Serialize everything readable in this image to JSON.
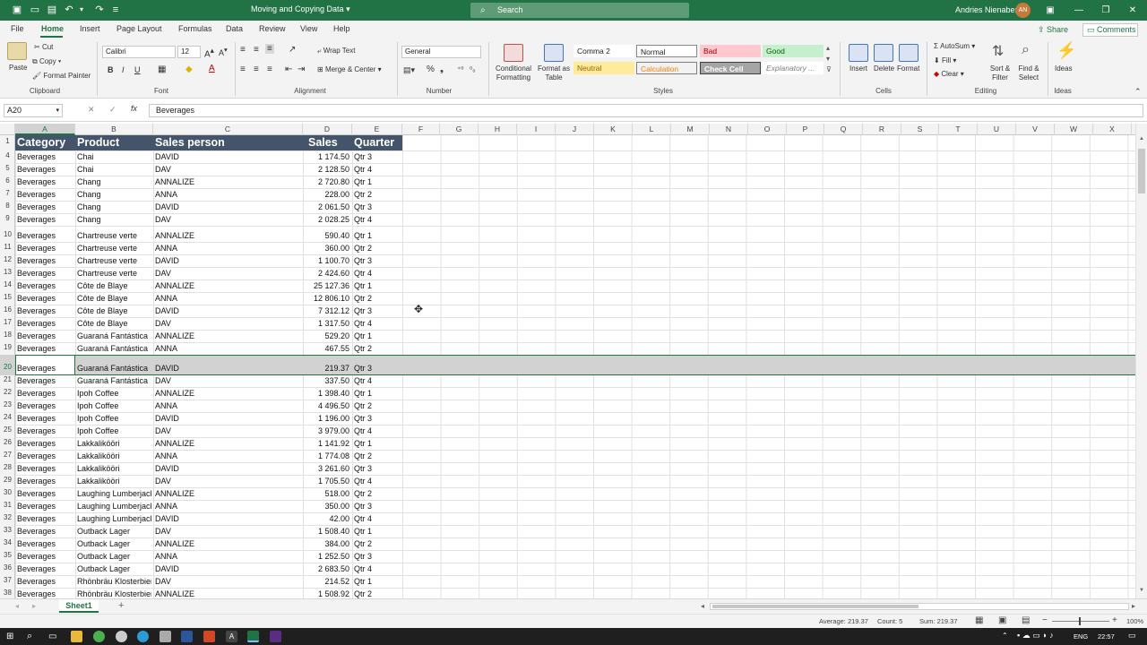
{
  "titlebar": {
    "title": "Moving and Copying Data",
    "title_caret": "▾",
    "search_placeholder": "Search",
    "user_name": "Andries Nienaber",
    "user_initials": "AN",
    "autosave_icon": "excel-logo",
    "qa_icons": [
      "open-icon",
      "save-icon",
      "undo-icon",
      "redo-icon",
      "customize-icon"
    ]
  },
  "menu": {
    "items": [
      "File",
      "Home",
      "Insert",
      "Page Layout",
      "Formulas",
      "Data",
      "Review",
      "View",
      "Help"
    ],
    "share": "Share",
    "comments": "Comments"
  },
  "ribbon": {
    "clipboard": {
      "paste": "Paste",
      "cut": "Cut",
      "copy": "Copy",
      "format_painter": "Format Painter",
      "group": "Clipboard"
    },
    "font": {
      "name": "Calibri",
      "size": "12",
      "group": "Font",
      "bold": "B",
      "italic": "I",
      "underline": "U"
    },
    "alignment": {
      "wrap": "Wrap Text",
      "merge": "Merge & Center",
      "group": "Alignment"
    },
    "number": {
      "format": "General",
      "group": "Number"
    },
    "styles": {
      "conditional": "Conditional Formatting",
      "format_table": "Format as Table",
      "cells": [
        {
          "label": "Comma 2",
          "bg": "#ffffff",
          "fg": "#222222"
        },
        {
          "label": "Normal",
          "bg": "#ffffff",
          "fg": "#222222"
        },
        {
          "label": "Bad",
          "bg": "#ffc7ce",
          "fg": "#9c0006"
        },
        {
          "label": "Good",
          "bg": "#c6efce",
          "fg": "#006100"
        },
        {
          "label": "Neutral",
          "bg": "#ffeb9c",
          "fg": "#9c6500"
        },
        {
          "label": "Calculation",
          "bg": "#f2f2f2",
          "fg": "#fa7d00"
        },
        {
          "label": "Check Cell",
          "bg": "#a5a5a5",
          "fg": "#ffffff"
        },
        {
          "label": "Explanatory ...",
          "bg": "#ffffff",
          "fg": "#7f7f7f"
        }
      ],
      "group": "Styles"
    },
    "cells": {
      "insert": "Insert",
      "delete": "Delete",
      "format": "Format",
      "group": "Cells"
    },
    "editing": {
      "autosum": "AutoSum",
      "fill": "Fill",
      "clear": "Clear",
      "sort": "Sort & Filter",
      "find": "Find & Select",
      "group": "Editing"
    },
    "ideas": {
      "label": "Ideas",
      "group": "Ideas"
    }
  },
  "formula_bar": {
    "name_box": "A20",
    "content": "Beverages",
    "fx": "fx"
  },
  "columns": [
    "A",
    "B",
    "C",
    "D",
    "E",
    "F",
    "G",
    "H",
    "I",
    "J",
    "K",
    "L",
    "M",
    "N",
    "O",
    "P",
    "Q",
    "R",
    "S",
    "T",
    "U",
    "V",
    "W",
    "X"
  ],
  "headers": [
    "Category",
    "Product",
    "Sales person",
    "Sales",
    "Quarter"
  ],
  "rows": [
    {
      "n": "4",
      "c": "Beverages",
      "p": "Chai",
      "s": "DAVID",
      "v": "1 174.50",
      "q": "Qtr 3"
    },
    {
      "n": "5",
      "c": "Beverages",
      "p": "Chai",
      "s": "DAV",
      "v": "2 128.50",
      "q": "Qtr 4"
    },
    {
      "n": "6",
      "c": "Beverages",
      "p": "Chang",
      "s": "ANNALIZE",
      "v": "2 720.80",
      "q": "Qtr 1"
    },
    {
      "n": "7",
      "c": "Beverages",
      "p": "Chang",
      "s": "ANNA",
      "v": "228.00",
      "q": "Qtr 2"
    },
    {
      "n": "8",
      "c": "Beverages",
      "p": "Chang",
      "s": "DAVID",
      "v": "2 061.50",
      "q": "Qtr 3"
    },
    {
      "n": "9",
      "c": "Beverages",
      "p": "Chang",
      "s": "DAV",
      "v": "2 028.25",
      "q": "Qtr 4"
    },
    {
      "n": "10",
      "c": "Beverages",
      "p": "Chartreuse    verte",
      "s": "ANNALIZE",
      "v": "590.40",
      "q": "Qtr 1"
    },
    {
      "n": "11",
      "c": "Beverages",
      "p": "Chartreuse verte",
      "s": "ANNA",
      "v": "360.00",
      "q": "Qtr 2"
    },
    {
      "n": "12",
      "c": "Beverages",
      "p": "Chartreuse verte",
      "s": "DAVID",
      "v": "1 100.70",
      "q": "Qtr 3"
    },
    {
      "n": "13",
      "c": "Beverages",
      "p": "Chartreuse verte",
      "s": "DAV",
      "v": "2 424.60",
      "q": "Qtr 4"
    },
    {
      "n": "14",
      "c": "Beverages",
      "p": "Côte de Blaye",
      "s": "ANNALIZE",
      "v": "25 127.36",
      "q": "Qtr 1"
    },
    {
      "n": "15",
      "c": "Beverages",
      "p": "Côte de Blaye",
      "s": "ANNA",
      "v": "12 806.10",
      "q": "Qtr 2"
    },
    {
      "n": "16",
      "c": "Beverages",
      "p": "Côte de Blaye",
      "s": "DAVID",
      "v": "7 312.12",
      "q": "Qtr 3"
    },
    {
      "n": "17",
      "c": "Beverages",
      "p": "Côte de Blaye",
      "s": "DAV",
      "v": "1 317.50",
      "q": "Qtr 4"
    },
    {
      "n": "18",
      "c": "Beverages",
      "p": "Guaraná Fantástica",
      "s": "ANNALIZE",
      "v": "529.20",
      "q": "Qtr 1"
    },
    {
      "n": "19",
      "c": "Beverages",
      "p": "Guaraná Fantástica",
      "s": "ANNA",
      "v": "467.55",
      "q": "Qtr 2"
    },
    {
      "n": "20",
      "c": "Beverages",
      "p": "Guaraná Fantástica",
      "s": "DAVID",
      "v": "219.37",
      "q": "Qtr 3"
    },
    {
      "n": "21",
      "c": "Beverages",
      "p": "Guaraná Fantástica",
      "s": "DAV",
      "v": "337.50",
      "q": "Qtr 4"
    },
    {
      "n": "22",
      "c": "Beverages",
      "p": "Ipoh Coffee",
      "s": "ANNALIZE",
      "v": "1 398.40",
      "q": "Qtr 1"
    },
    {
      "n": "23",
      "c": "Beverages",
      "p": "Ipoh Coffee",
      "s": "ANNA",
      "v": "4 496.50",
      "q": "Qtr 2"
    },
    {
      "n": "24",
      "c": "Beverages",
      "p": "Ipoh Coffee",
      "s": "DAVID",
      "v": "1 196.00",
      "q": "Qtr 3"
    },
    {
      "n": "25",
      "c": "Beverages",
      "p": "Ipoh Coffee",
      "s": "DAV",
      "v": "3 979.00",
      "q": "Qtr 4"
    },
    {
      "n": "26",
      "c": "Beverages",
      "p": "Lakkalikööri",
      "s": "ANNALIZE",
      "v": "1 141.92",
      "q": "Qtr 1"
    },
    {
      "n": "27",
      "c": "Beverages",
      "p": "Lakkalikööri",
      "s": "ANNA",
      "v": "1 774.08",
      "q": "Qtr 2"
    },
    {
      "n": "28",
      "c": "Beverages",
      "p": "Lakkalikööri",
      "s": "DAVID",
      "v": "3 261.60",
      "q": "Qtr 3"
    },
    {
      "n": "29",
      "c": "Beverages",
      "p": "Lakkalikööri",
      "s": "DAV",
      "v": "1 705.50",
      "q": "Qtr 4"
    },
    {
      "n": "30",
      "c": "Beverages",
      "p": "Laughing Lumberjack",
      "s": "ANNALIZE",
      "v": "518.00",
      "q": "Qtr 2"
    },
    {
      "n": "31",
      "c": "Beverages",
      "p": "Laughing Lumberjack",
      "s": "ANNA",
      "v": "350.00",
      "q": "Qtr 3"
    },
    {
      "n": "32",
      "c": "Beverages",
      "p": "Laughing Lumberjack",
      "s": "DAVID",
      "v": "42.00",
      "q": "Qtr 4"
    },
    {
      "n": "33",
      "c": "Beverages",
      "p": "Outback Lager",
      "s": "DAV",
      "v": "1 508.40",
      "q": "Qtr 1"
    },
    {
      "n": "34",
      "c": "Beverages",
      "p": "Outback Lager",
      "s": "ANNALIZE",
      "v": "384.00",
      "q": "Qtr 2"
    },
    {
      "n": "35",
      "c": "Beverages",
      "p": "Outback Lager",
      "s": "ANNA",
      "v": "1 252.50",
      "q": "Qtr 3"
    },
    {
      "n": "36",
      "c": "Beverages",
      "p": "Outback Lager",
      "s": "DAVID",
      "v": "2 683.50",
      "q": "Qtr 4"
    },
    {
      "n": "37",
      "c": "Beverages",
      "p": "Rhönbräu Klosterbier",
      "s": "DAV",
      "v": "214.52",
      "q": "Qtr 1"
    },
    {
      "n": "38",
      "c": "Beverages",
      "p": "Rhönbräu Klosterbier",
      "s": "ANNALIZE",
      "v": "1 508.92",
      "q": "Qtr 2"
    }
  ],
  "selected_row": "20",
  "sheet": {
    "tab": "Sheet1",
    "add": "+"
  },
  "status": {
    "average": "Average: 219.37",
    "count": "Count: 5",
    "sum": "Sum: 219.37",
    "zoom": "100%"
  },
  "taskbar": {
    "lang": "ENG",
    "time": "22:57"
  },
  "colors": {
    "accent": "#217346",
    "header_bg": "#44546a",
    "selected_row": "#d2d2d2"
  }
}
